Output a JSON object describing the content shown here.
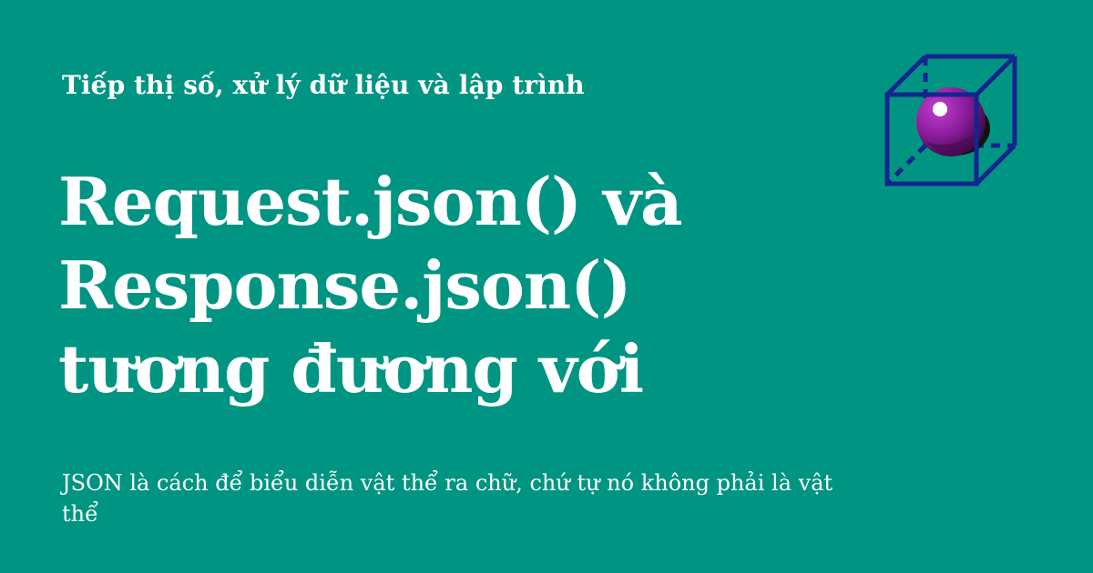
{
  "card": {
    "kicker": "Tiếp thị số, xử lý dữ liệu và lập trình",
    "title_lines": [
      "Request.json() và",
      "Response.json()",
      "tương đương với"
    ],
    "description": "JSON là cách để biểu diễn vật thể ra chữ, chứ tự nó không phải là vật thể"
  },
  "logo": {
    "icon": "cube-with-sphere-icon"
  },
  "colors": {
    "background": "#009582",
    "text": "#ffffff",
    "cube_stroke": "#142590",
    "sphere": "#8b1c9b"
  }
}
